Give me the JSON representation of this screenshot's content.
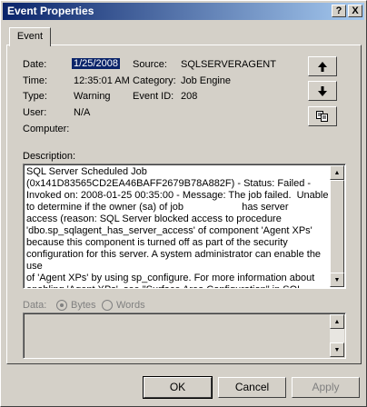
{
  "window": {
    "title": "Event Properties"
  },
  "titlebar_buttons": {
    "help": "?",
    "close": "X"
  },
  "tabs": [
    {
      "label": "Event"
    }
  ],
  "fields": {
    "date_label": "Date:",
    "date_value": "1/25/2008",
    "source_label": "Source:",
    "source_value": "SQLSERVERAGENT",
    "time_label": "Time:",
    "time_value": "12:35:01 AM",
    "category_label": "Category:",
    "category_value": "Job Engine",
    "type_label": "Type:",
    "type_value": "Warning",
    "eventid_label": "Event ID:",
    "eventid_value": "208",
    "user_label": "User:",
    "user_value": "N/A",
    "computer_label": "Computer:",
    "computer_value": ""
  },
  "description": {
    "label": "Description:",
    "text": "SQL Server Scheduled Job\n(0x141D83565CD2EA46BAFF2679B78A882F) - Status: Failed -\nInvoked on: 2008-01-25 00:35:00 - Message: The job failed.  Unable\nto determine if the owner (sa) of job                     has server\naccess (reason: SQL Server blocked access to procedure\n'dbo.sp_sqlagent_has_server_access' of component 'Agent XPs'\nbecause this component is turned off as part of the security\nconfiguration for this server. A system administrator can enable the use\nof 'Agent XPs' by using sp_configure. For more information about\nenabling 'Agent XPs', see \"Surface Area Configuration\" in SQL Server"
  },
  "data_section": {
    "label": "Data:",
    "option_bytes": "Bytes",
    "option_words": "Words",
    "selected": "Bytes"
  },
  "buttons": {
    "ok": "OK",
    "cancel": "Cancel",
    "apply": "Apply"
  },
  "icons": {
    "up": "arrow-up-icon",
    "down": "arrow-down-icon",
    "copy": "copy-icon"
  }
}
